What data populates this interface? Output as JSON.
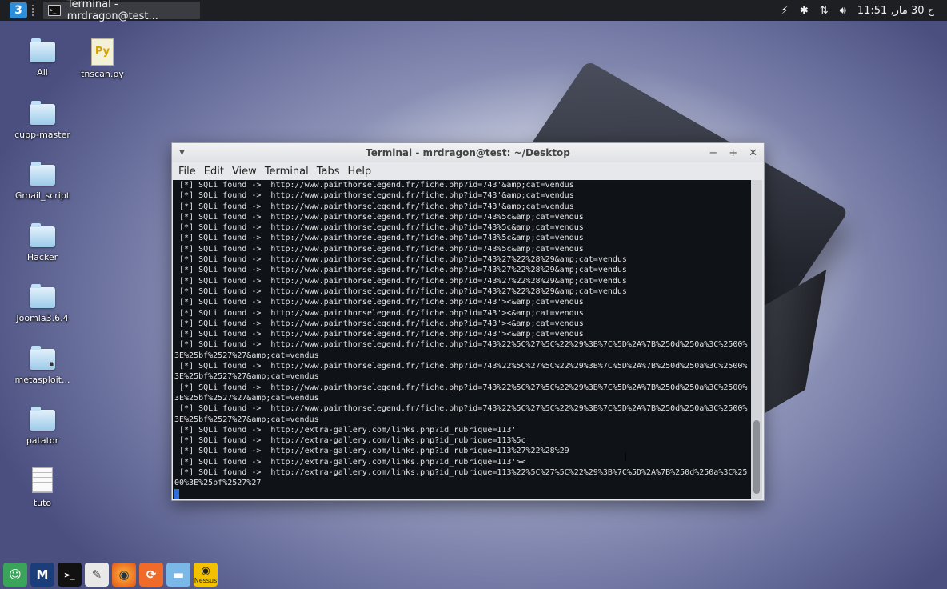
{
  "top_panel": {
    "menu_icon": "3",
    "task_title": "Terminal - mrdragon@test...",
    "clock": "ح 30 مار, 11:51",
    "tray_icons": [
      "power-icon",
      "bluetooth-icon",
      "network-icon",
      "volume-icon"
    ]
  },
  "desktop": {
    "icons": [
      {
        "label": "All",
        "kind": "folder"
      },
      {
        "label": "tnscan.py",
        "kind": "python"
      },
      {
        "label": "cupp-master",
        "kind": "folder"
      },
      {
        "label": "Gmail_script",
        "kind": "folder"
      },
      {
        "label": "Hacker",
        "kind": "folder"
      },
      {
        "label": "Joomla3.6.4",
        "kind": "folder"
      },
      {
        "label": "metasploit...",
        "kind": "folder-locked"
      },
      {
        "label": "patator",
        "kind": "folder"
      },
      {
        "label": "tuto",
        "kind": "text"
      }
    ]
  },
  "terminal": {
    "title": "Terminal - mrdragon@test: ~/Desktop",
    "menu": [
      "File",
      "Edit",
      "View",
      "Terminal",
      "Tabs",
      "Help"
    ],
    "lines": [
      " [*] SQLi found ->  http://www.painthorselegend.fr/fiche.php?id=743'&amp;cat=vendus",
      " [*] SQLi found ->  http://www.painthorselegend.fr/fiche.php?id=743'&amp;cat=vendus",
      " [*] SQLi found ->  http://www.painthorselegend.fr/fiche.php?id=743'&amp;cat=vendus",
      " [*] SQLi found ->  http://www.painthorselegend.fr/fiche.php?id=743%5c&amp;cat=vendus",
      " [*] SQLi found ->  http://www.painthorselegend.fr/fiche.php?id=743%5c&amp;cat=vendus",
      " [*] SQLi found ->  http://www.painthorselegend.fr/fiche.php?id=743%5c&amp;cat=vendus",
      " [*] SQLi found ->  http://www.painthorselegend.fr/fiche.php?id=743%5c&amp;cat=vendus",
      " [*] SQLi found ->  http://www.painthorselegend.fr/fiche.php?id=743%27%22%28%29&amp;cat=vendus",
      " [*] SQLi found ->  http://www.painthorselegend.fr/fiche.php?id=743%27%22%28%29&amp;cat=vendus",
      " [*] SQLi found ->  http://www.painthorselegend.fr/fiche.php?id=743%27%22%28%29&amp;cat=vendus",
      " [*] SQLi found ->  http://www.painthorselegend.fr/fiche.php?id=743%27%22%28%29&amp;cat=vendus",
      " [*] SQLi found ->  http://www.painthorselegend.fr/fiche.php?id=743'><&amp;cat=vendus",
      " [*] SQLi found ->  http://www.painthorselegend.fr/fiche.php?id=743'><&amp;cat=vendus",
      " [*] SQLi found ->  http://www.painthorselegend.fr/fiche.php?id=743'><&amp;cat=vendus",
      " [*] SQLi found ->  http://www.painthorselegend.fr/fiche.php?id=743'><&amp;cat=vendus",
      " [*] SQLi found ->  http://www.painthorselegend.fr/fiche.php?id=743%22%5C%27%5C%22%29%3B%7C%5D%2A%7B%250d%250a%3C%2500%3E%25bf%2527%27&amp;cat=vendus",
      " [*] SQLi found ->  http://www.painthorselegend.fr/fiche.php?id=743%22%5C%27%5C%22%29%3B%7C%5D%2A%7B%250d%250a%3C%2500%3E%25bf%2527%27&amp;cat=vendus",
      " [*] SQLi found ->  http://www.painthorselegend.fr/fiche.php?id=743%22%5C%27%5C%22%29%3B%7C%5D%2A%7B%250d%250a%3C%2500%3E%25bf%2527%27&amp;cat=vendus",
      " [*] SQLi found ->  http://www.painthorselegend.fr/fiche.php?id=743%22%5C%27%5C%22%29%3B%7C%5D%2A%7B%250d%250a%3C%2500%3E%25bf%2527%27&amp;cat=vendus",
      " [*] SQLi found ->  http://extra-gallery.com/links.php?id_rubrique=113'",
      " [*] SQLi found ->  http://extra-gallery.com/links.php?id_rubrique=113%5c",
      " [*] SQLi found ->  http://extra-gallery.com/links.php?id_rubrique=113%27%22%28%29",
      " [*] SQLi found ->  http://extra-gallery.com/links.php?id_rubrique=113'><",
      " [*] SQLi found ->  http://extra-gallery.com/links.php?id_rubrique=113%22%5C%27%5C%22%29%3B%7C%5D%2A%7B%250d%250a%3C%2500%3E%25bf%2527%27"
    ]
  },
  "dock": {
    "items": [
      {
        "name": "avatar-icon",
        "label": ""
      },
      {
        "name": "metasploit-icon",
        "label": ""
      },
      {
        "name": "terminal-icon",
        "label": ""
      },
      {
        "name": "text-editor-icon",
        "label": ""
      },
      {
        "name": "firefox-icon",
        "label": ""
      },
      {
        "name": "update-icon",
        "label": ""
      },
      {
        "name": "file-manager-icon",
        "label": ""
      },
      {
        "name": "nessus-icon",
        "label": "Nessus"
      }
    ]
  }
}
